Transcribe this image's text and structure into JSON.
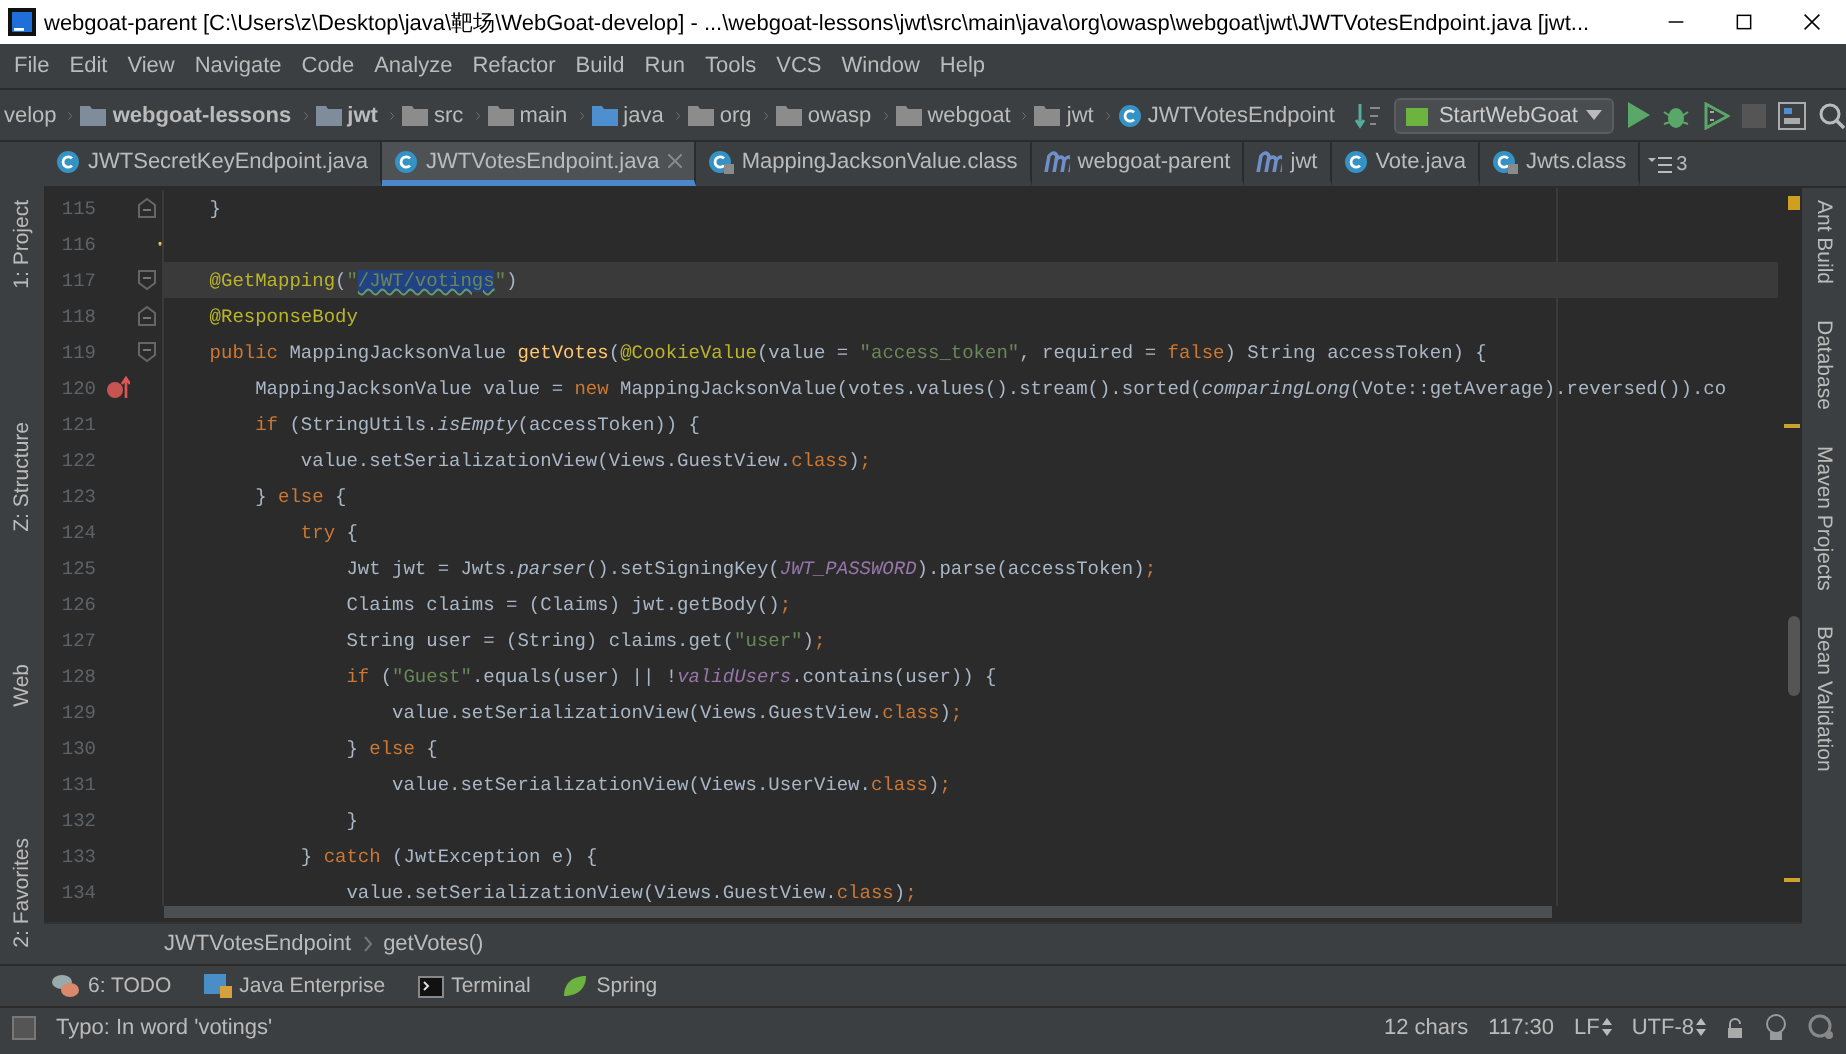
{
  "window": {
    "title": "webgoat-parent [C:\\Users\\z\\Desktop\\java\\靶场\\WebGoat-develop] - ...\\webgoat-lessons\\jwt\\src\\main\\java\\org\\owasp\\webgoat\\jwt\\JWTVotesEndpoint.java [jwt..."
  },
  "menu": [
    "File",
    "Edit",
    "View",
    "Navigate",
    "Code",
    "Analyze",
    "Refactor",
    "Build",
    "Run",
    "Tools",
    "VCS",
    "Window",
    "Help"
  ],
  "nav_path": [
    {
      "label": "velop",
      "kind": "plain"
    },
    {
      "label": "webgoat-lessons",
      "kind": "module"
    },
    {
      "label": "jwt",
      "kind": "module"
    },
    {
      "label": "src",
      "kind": "folder"
    },
    {
      "label": "main",
      "kind": "folder"
    },
    {
      "label": "java",
      "kind": "source"
    },
    {
      "label": "org",
      "kind": "folder"
    },
    {
      "label": "owasp",
      "kind": "folder"
    },
    {
      "label": "webgoat",
      "kind": "folder"
    },
    {
      "label": "jwt",
      "kind": "folder"
    },
    {
      "label": "JWTVotesEndpoint",
      "kind": "class"
    }
  ],
  "run_config": "StartWebGoat",
  "tabs": [
    {
      "label": "JWTSecretKeyEndpoint.java",
      "kind": "class",
      "selected": false
    },
    {
      "label": "JWTVotesEndpoint.java",
      "kind": "class",
      "selected": true
    },
    {
      "label": "MappingJacksonValue.class",
      "kind": "classfile",
      "selected": false
    },
    {
      "label": "webgoat-parent",
      "kind": "maven",
      "selected": false
    },
    {
      "label": "jwt",
      "kind": "maven",
      "selected": false
    },
    {
      "label": "Vote.java",
      "kind": "class",
      "selected": false
    },
    {
      "label": "Jwts.class",
      "kind": "classfile",
      "selected": false
    }
  ],
  "tab_overflow": "3",
  "left_tools": [
    "1: Project",
    "Z: Structure",
    "Web",
    "2: Favorites"
  ],
  "right_tools": [
    "Ant Build",
    "Database",
    "Maven Projects",
    "Bean Validation"
  ],
  "editor": {
    "lines": [
      {
        "number": "115",
        "kind": "fold-end",
        "current": false,
        "tokens": [
          {
            "kind": "plain",
            "text": "    }"
          }
        ]
      },
      {
        "number": "116",
        "kind": "bulb",
        "current": false
      },
      {
        "number": "117",
        "kind": "fold-start",
        "current": true,
        "tokens": [
          {
            "kind": "ann",
            "text": "    @GetMapping"
          },
          {
            "kind": "plain",
            "text": "("
          },
          {
            "kind": "str",
            "text": "\""
          },
          {
            "kind": "sel",
            "text": "/JWT/votings"
          },
          {
            "kind": "str",
            "text": "\""
          },
          {
            "kind": "plain",
            "text": ")"
          }
        ]
      },
      {
        "number": "118",
        "kind": "fold-end",
        "current": false,
        "tokens": [
          {
            "kind": "ann",
            "text": "    @ResponseBody"
          }
        ]
      },
      {
        "number": "119",
        "kind": "fold-start",
        "current": false,
        "tokens": [
          {
            "kind": "kw",
            "text": "    public"
          },
          {
            "kind": "plain",
            "text": " MappingJacksonValue "
          },
          {
            "kind": "fn",
            "text": "getVotes"
          },
          {
            "kind": "plain",
            "text": "("
          },
          {
            "kind": "ann",
            "text": "@CookieValue"
          },
          {
            "kind": "plain",
            "text": "(value = "
          },
          {
            "kind": "str",
            "text": "\"access_token\""
          },
          {
            "kind": "plain",
            "text": ", required = "
          },
          {
            "kind": "kw",
            "text": "false"
          },
          {
            "kind": "plain",
            "text": ") String accessToken) {"
          }
        ]
      },
      {
        "number": "120",
        "kind": "override",
        "current": false,
        "tokens": [
          {
            "kind": "plain",
            "text": "        MappingJacksonValue value = "
          },
          {
            "kind": "kw",
            "text": "new"
          },
          {
            "kind": "plain",
            "text": " MappingJacksonValue(votes.values().stream().sorted("
          },
          {
            "kind": "static",
            "text": "comparingLong"
          },
          {
            "kind": "plain",
            "text": "(Vote::getAverage).reversed()).co"
          }
        ]
      },
      {
        "number": "121",
        "current": false,
        "tokens": [
          {
            "kind": "kw",
            "text": "        if"
          },
          {
            "kind": "plain",
            "text": " (StringUtils."
          },
          {
            "kind": "static",
            "text": "isEmpty"
          },
          {
            "kind": "plain",
            "text": "(accessToken)) {"
          }
        ]
      },
      {
        "number": "122",
        "current": false,
        "tokens": [
          {
            "kind": "plain",
            "text": "            value.setSerializationView(Views.GuestView."
          },
          {
            "kind": "kw",
            "text": "class"
          },
          {
            "kind": "plain",
            "text": ")"
          },
          {
            "kind": "kw",
            "text": ";"
          }
        ]
      },
      {
        "number": "123",
        "current": false,
        "tokens": [
          {
            "kind": "plain",
            "text": "        } "
          },
          {
            "kind": "kw",
            "text": "else"
          },
          {
            "kind": "plain",
            "text": " {"
          }
        ]
      },
      {
        "number": "124",
        "current": false,
        "tokens": [
          {
            "kind": "kw",
            "text": "            try"
          },
          {
            "kind": "plain",
            "text": " {"
          }
        ]
      },
      {
        "number": "125",
        "current": false,
        "tokens": [
          {
            "kind": "plain",
            "text": "                Jwt jwt = Jwts."
          },
          {
            "kind": "static",
            "text": "parser"
          },
          {
            "kind": "plain",
            "text": "().setSigningKey("
          },
          {
            "kind": "const",
            "text": "JWT_PASSWORD"
          },
          {
            "kind": "plain",
            "text": ").parse(accessToken)"
          },
          {
            "kind": "kw",
            "text": ";"
          }
        ]
      },
      {
        "number": "126",
        "current": false,
        "tokens": [
          {
            "kind": "plain",
            "text": "                Claims claims = (Claims) jwt.getBody()"
          },
          {
            "kind": "kw",
            "text": ";"
          }
        ]
      },
      {
        "number": "127",
        "current": false,
        "tokens": [
          {
            "kind": "plain",
            "text": "                String user = (String) claims.get("
          },
          {
            "kind": "str",
            "text": "\"user\""
          },
          {
            "kind": "plain",
            "text": ")"
          },
          {
            "kind": "kw",
            "text": ";"
          }
        ]
      },
      {
        "number": "128",
        "current": false,
        "tokens": [
          {
            "kind": "kw",
            "text": "                if"
          },
          {
            "kind": "plain",
            "text": " ("
          },
          {
            "kind": "str",
            "text": "\"Guest\""
          },
          {
            "kind": "plain",
            "text": ".equals(user) || !"
          },
          {
            "kind": "const",
            "text": "validUsers"
          },
          {
            "kind": "plain",
            "text": ".contains(user)) {"
          }
        ]
      },
      {
        "number": "129",
        "current": false,
        "tokens": [
          {
            "kind": "plain",
            "text": "                    value.setSerializationView(Views.GuestView."
          },
          {
            "kind": "kw",
            "text": "class"
          },
          {
            "kind": "plain",
            "text": ")"
          },
          {
            "kind": "kw",
            "text": ";"
          }
        ]
      },
      {
        "number": "130",
        "current": false,
        "tokens": [
          {
            "kind": "plain",
            "text": "                } "
          },
          {
            "kind": "kw",
            "text": "else"
          },
          {
            "kind": "plain",
            "text": " {"
          }
        ]
      },
      {
        "number": "131",
        "current": false,
        "tokens": [
          {
            "kind": "plain",
            "text": "                    value.setSerializationView(Views.UserView."
          },
          {
            "kind": "kw",
            "text": "class"
          },
          {
            "kind": "plain",
            "text": ")"
          },
          {
            "kind": "kw",
            "text": ";"
          }
        ]
      },
      {
        "number": "132",
        "current": false,
        "tokens": [
          {
            "kind": "plain",
            "text": "                }"
          }
        ]
      },
      {
        "number": "133",
        "current": false,
        "tokens": [
          {
            "kind": "plain",
            "text": "            } "
          },
          {
            "kind": "kw",
            "text": "catch"
          },
          {
            "kind": "plain",
            "text": " (JwtException e) {"
          }
        ]
      },
      {
        "number": "134",
        "current": false,
        "tokens": [
          {
            "kind": "plain",
            "text": "                value.setSerializationView(Views.GuestView."
          },
          {
            "kind": "kw",
            "text": "class"
          },
          {
            "kind": "plain",
            "text": ")"
          },
          {
            "kind": "kw",
            "text": ";"
          }
        ]
      }
    ],
    "breadcrumb": [
      "JWTVotesEndpoint",
      "getVotes()"
    ]
  },
  "tool_windows": [
    {
      "label": "6: TODO",
      "kind": "todo"
    },
    {
      "label": "Java Enterprise",
      "kind": "enterprise"
    },
    {
      "label": "Terminal",
      "kind": "terminal"
    },
    {
      "label": "Spring",
      "kind": "spring"
    }
  ],
  "status_bar": {
    "message": "Typo: In word 'votings'",
    "items": [
      {
        "label": "12 chars",
        "kind": "text"
      },
      {
        "label": "117:30",
        "kind": "text"
      },
      {
        "label": "LF",
        "kind": "select"
      },
      {
        "label": "UTF-8",
        "kind": "select"
      }
    ]
  }
}
